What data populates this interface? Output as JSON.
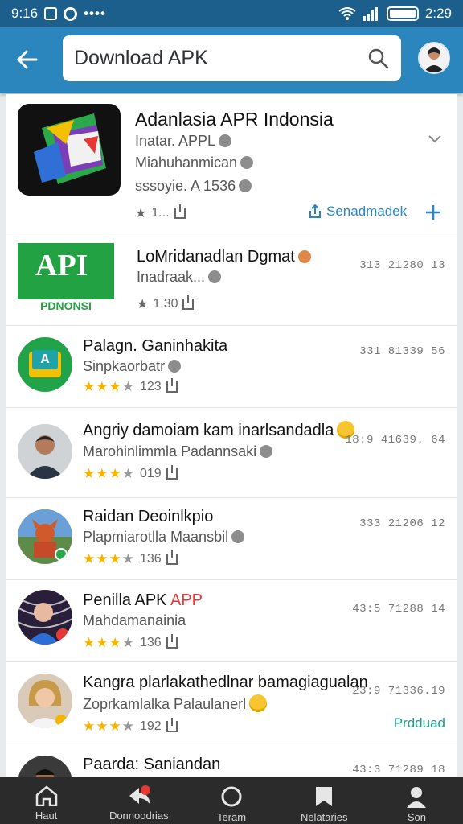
{
  "status_bar": {
    "time_left": "9:16",
    "dots": "••••",
    "time_right": "2:29",
    "icons": [
      "lock-icon",
      "circle-app-icon",
      "wifi-icon",
      "signal-icon",
      "battery-icon"
    ]
  },
  "header": {
    "search_value": "Download APK",
    "icons": [
      "back-arrow-icon",
      "search-icon",
      "avatar"
    ]
  },
  "items": [
    {
      "title": "Adanlasia APR Indonsia",
      "sub1": "Inatar. APPL",
      "sub2": "Miahuhanmican",
      "sub3": "sssoyie. A 1536",
      "meta": "1...",
      "action": "Senadmadek"
    },
    {
      "title": "LoMridanadlan Dgmat",
      "sub": "Inadraak...",
      "meta": "1.30",
      "code": "313 21280 13",
      "logo_top": "API",
      "logo_bottom": "PDNONSI"
    },
    {
      "title": "Palagn. Ganinhakita",
      "sub": "Sinpkaorbatr",
      "meta": "123",
      "code": "331 81339 56"
    },
    {
      "title": "Angriy damoiam kam inarlsandadla",
      "sub": "Marohinlimmla Padannsaki",
      "meta": "019",
      "code": "18:9 41639. 64"
    },
    {
      "title": "Raidan Deoinlkpio",
      "sub": "Plapmiarotlla Maansbil",
      "meta": "136",
      "code": "333 21206 12"
    },
    {
      "title": "Penilla APK",
      "title_red": "APP",
      "sub": "Mahdamanainia",
      "meta": "136",
      "code": "43:5 71288 14"
    },
    {
      "title": "Kangra plarlakathedlnar bamagiagualan",
      "sub": "Zoprkamlalka Palaulanerl",
      "meta": "192",
      "code": "23:9 71336.19",
      "action": "Prdduad"
    },
    {
      "title": "Paarda: Saniandan",
      "code": "43:3 71289 18"
    }
  ],
  "bottom_nav": [
    {
      "label": "Haut",
      "icon": "home-icon"
    },
    {
      "label": "Donnoodrias",
      "icon": "arrow-badge-icon"
    },
    {
      "label": "Teram",
      "icon": "circle-icon"
    },
    {
      "label": "Nelataries",
      "icon": "bookmark-icon"
    },
    {
      "label": "Son",
      "icon": "person-icon"
    }
  ],
  "colors": {
    "app_bar": "#2a86bd",
    "status_bar": "#1c5f8c",
    "accent": "#2a86bd",
    "star": "#f4b400",
    "green_action": "#1a9c8a"
  }
}
